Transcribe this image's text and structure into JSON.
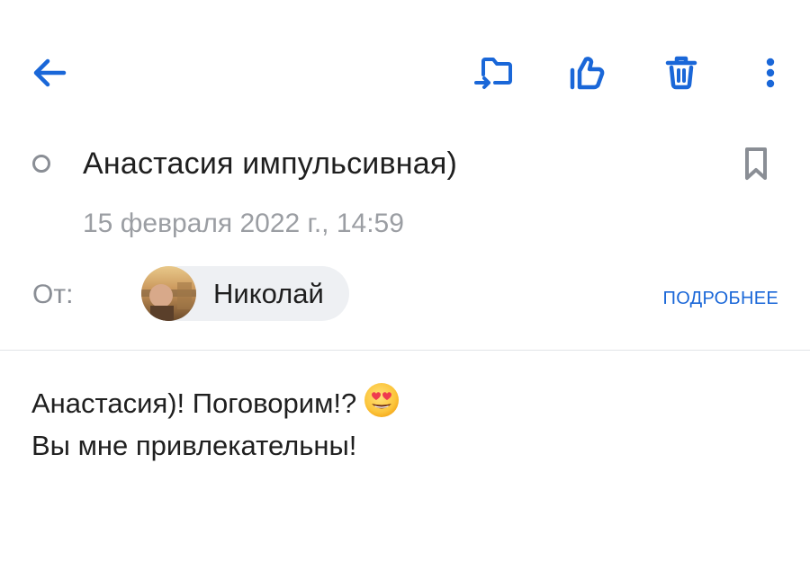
{
  "toolbar": {
    "back_icon": "arrow-left-icon",
    "move_icon": "folder-move-icon",
    "like_icon": "thumbs-up-icon",
    "delete_icon": "trash-icon",
    "more_icon": "more-vertical-icon",
    "accent_color": "#1a67d8"
  },
  "message": {
    "subject": "Анастасия импульсивная)",
    "date": "15 февраля 2022 г., 14:59",
    "from_label": "От:",
    "sender_name": "Николай",
    "details_link": "ПОДРОБНЕЕ",
    "body_lines": [
      "Анастасия)! Поговорим!?",
      "Вы мне привлекательны!"
    ],
    "body_emoji": "smiling-face-with-heart-eyes-emoji"
  }
}
